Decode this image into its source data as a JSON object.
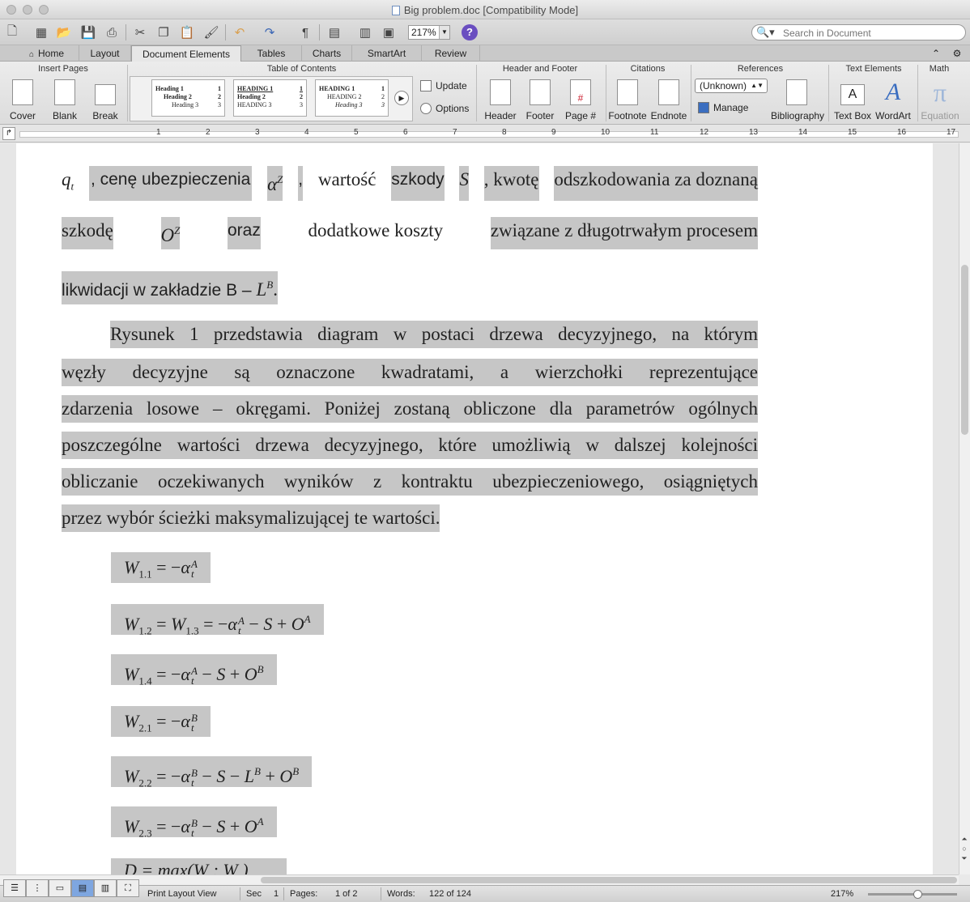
{
  "window": {
    "title": "Big problem.doc [Compatibility Mode]"
  },
  "toolbar": {
    "zoom": "217%",
    "search_placeholder": "Search in Document",
    "help": "?",
    "pilcrow": "¶"
  },
  "tabs": [
    "Home",
    "Layout",
    "Document Elements",
    "Tables",
    "Charts",
    "SmartArt",
    "Review"
  ],
  "ribbon": {
    "groups": {
      "insert_pages": "Insert Pages",
      "toc": "Table of Contents",
      "header_footer": "Header and Footer",
      "citations": "Citations",
      "references": "References",
      "text_elements": "Text Elements",
      "math": "Math"
    },
    "buttons": {
      "cover": "Cover",
      "blank": "Blank",
      "break": "Break",
      "update": "Update",
      "options": "Options",
      "header": "Header",
      "footer": "Footer",
      "page_num": "Page #",
      "footnote": "Footnote",
      "endnote": "Endnote",
      "manage": "Manage",
      "bibliography": "Bibliography",
      "text_box": "Text Box",
      "wordart": "WordArt",
      "equation": "Equation"
    },
    "citation_style": "(Unknown)",
    "toc_thumbs": [
      {
        "rows": [
          [
            "Heading 1",
            "1"
          ],
          [
            "Heading 2",
            "2"
          ],
          [
            "Heading 3",
            "3"
          ]
        ]
      },
      {
        "rows": [
          [
            "HEADING 1",
            "1"
          ],
          [
            "Heading 2",
            "2"
          ],
          [
            "HEADING 3",
            "3"
          ]
        ]
      },
      {
        "rows": [
          [
            "HEADING 1",
            "1"
          ],
          [
            "HEADING 2",
            "2"
          ],
          [
            "Heading 3",
            "3"
          ]
        ]
      }
    ]
  },
  "ruler": {
    "numbers": [
      "1",
      "2",
      "3",
      "4",
      "5",
      "6",
      "7",
      "8",
      "9",
      "10",
      "11",
      "12",
      "13",
      "14",
      "15",
      "16",
      "17"
    ]
  },
  "document": {
    "l1": {
      "q": "q",
      "q_sub": "t",
      "a": ", cenę ubezpieczenia",
      "alpha": "α",
      "alpha_sup": "Z",
      "b": ", ",
      "c": "wartość",
      "d": "szkody",
      "s": "S",
      "e": ", kwotę",
      "f": "odszkodowania za doznaną"
    },
    "l2": {
      "a": "szkodę",
      "o": "O",
      "o_sup": "Z",
      "b": "oraz",
      "c": "dodatkowe koszty",
      "d": "związane z długotrwałym procesem"
    },
    "l3": {
      "a": "likwidacji w zakładzie B – ",
      "l": "L",
      "l_sup": "B",
      "b": "."
    },
    "p2": [
      "Rysunek 1 przedstawia diagram w postaci drzewa decyzyjnego, na którym",
      "węzły decyzyjne są oznaczone kwadratami, a wierzchołki reprezentujące",
      "zdarzenia losowe – okręgami. Poniżej zostaną obliczone dla parametrów ogólnych",
      "poszczególne wartości drzewa decyzyjnego, które umożliwią w dalszej kolejności",
      "obliczanie oczekiwanych wyników z kontraktu ubezpieczeniowego, osiągniętych",
      "przez wybór ścieżki maksymalizującej te wartości."
    ],
    "equations": {
      "e1": {
        "lhs": "1.1",
        "sup": "A"
      },
      "e2": {
        "lhs": "1.2",
        "lhs2": "1.3",
        "sup": "A",
        "o_sup": "A"
      },
      "e3": {
        "lhs": "1.4",
        "sup": "A",
        "o_sup": "B"
      },
      "e4": {
        "lhs": "2.1",
        "sup": "B"
      },
      "e5": {
        "lhs": "2.2",
        "sup": "B",
        "l_sup": "B",
        "o_sup": "B"
      },
      "e6": {
        "lhs": "2.3",
        "sup": "B",
        "o_sup": "A"
      },
      "e7": {
        "text": "D",
        "rest": " = max(W  ; W  )"
      }
    }
  },
  "status": {
    "view": "Print Layout View",
    "sec_label": "Sec",
    "sec": "1",
    "pages_label": "Pages:",
    "pages": "1 of 2",
    "words_label": "Words:",
    "words": "122 of 124",
    "zoom": "217%"
  }
}
